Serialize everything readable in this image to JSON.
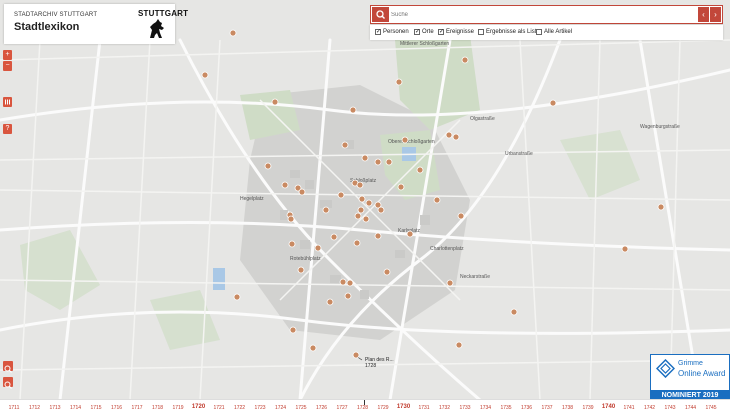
{
  "header": {
    "archive_label": "STADTARCHIV STUTTGART",
    "title": "Stadtlexikon",
    "city_logo": "STUTTGART"
  },
  "search": {
    "placeholder": "Suche",
    "prev_arrow": "‹",
    "next_arrow": "›"
  },
  "filters": [
    {
      "label": "Personen",
      "checked": true
    },
    {
      "label": "Orte",
      "checked": true
    },
    {
      "label": "Ereignisse",
      "checked": true
    },
    {
      "label": "Ergebnisse als Liste",
      "checked": false
    },
    {
      "label": "Alle Artikel",
      "checked": false
    }
  ],
  "map_labels": [
    "Mittlerer Schloßgarten",
    "Oberer Schloßgarten",
    "Schloßplatz",
    "Rotebühlplatz",
    "Karlsplatz",
    "Charlottenplatz",
    "Wagenburgstraße",
    "Urbanstraße",
    "Hegelplatz",
    "Neckarstraße",
    "Olgastraße"
  ],
  "selected_marker": {
    "name": "Plan des R...",
    "year": "1728"
  },
  "timeline": {
    "years": [
      "1711",
      "1712",
      "1713",
      "1714",
      "1715",
      "1716",
      "1717",
      "1718",
      "1719",
      "1720",
      "1721",
      "1722",
      "1723",
      "1724",
      "1725",
      "1726",
      "1727",
      "1728",
      "1729",
      "1730",
      "1731",
      "1732",
      "1733",
      "1734",
      "1735",
      "1736",
      "1737",
      "1738",
      "1739",
      "1740",
      "1741",
      "1742",
      "1743",
      "1744",
      "1745"
    ],
    "major": [
      "1720",
      "1730",
      "1740"
    ]
  },
  "award": {
    "line1": "Grimme",
    "line2": "Online Award",
    "badge": "NOMINIERT 2019"
  },
  "colors": {
    "accent": "#c2473a",
    "marker": "#c98a62",
    "award_blue": "#1a6ec0"
  }
}
